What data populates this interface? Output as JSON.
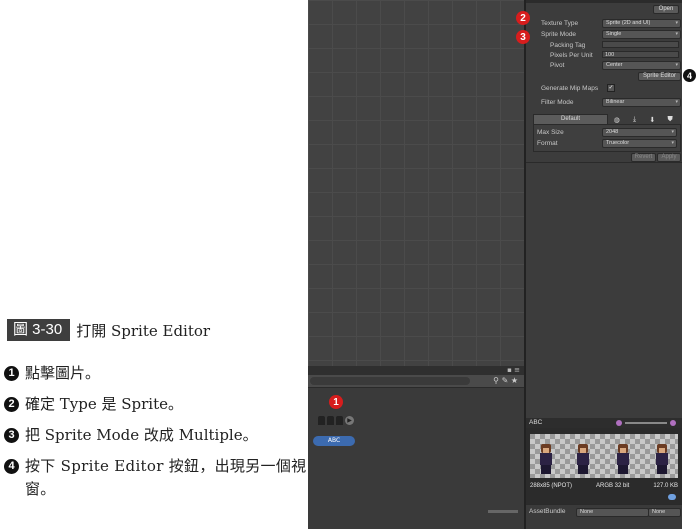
{
  "caption": {
    "label": "圖 3-30",
    "title": "打開 Sprite Editor"
  },
  "steps": [
    {
      "num": "1",
      "text": "點擊圖片。"
    },
    {
      "num": "2",
      "text": "確定 Type 是 Sprite。"
    },
    {
      "num": "3",
      "text": "把 Sprite Mode 改成 Multiple。"
    },
    {
      "num": "4",
      "text": "按下 Sprite Editor 按鈕，出現另一個視窗。"
    }
  ],
  "callouts": {
    "c1": "1",
    "c2": "2",
    "c3": "3",
    "c4": "4"
  },
  "project": {
    "asset_label": "ABC"
  },
  "inspector": {
    "open_button": "Open",
    "texture_type_label": "Texture Type",
    "texture_type_value": "Sprite (2D and UI)",
    "sprite_mode_label": "Sprite Mode",
    "sprite_mode_value": "Single",
    "packing_tag_label": "Packing Tag",
    "ppu_label": "Pixels Per Unit",
    "ppu_value": "100",
    "pivot_label": "Pivot",
    "pivot_value": "Center",
    "sprite_editor_button": "Sprite Editor",
    "mipmaps_label": "Generate Mip Maps",
    "mipmaps_checked": "✓",
    "filter_mode_label": "Filter Mode",
    "filter_mode_value": "Bilinear",
    "default_tab": "Default",
    "max_size_label": "Max Size",
    "max_size_value": "2048",
    "format_label": "Format",
    "format_value": "Truecolor",
    "revert_button": "Revert",
    "apply_button": "Apply"
  },
  "preview": {
    "title": "ABC",
    "info_left": "288x85 (NPOT)",
    "info_mid": "ARGB 32 bit",
    "info_right": "127.0 KB"
  },
  "assetbundle": {
    "label": "AssetBundle",
    "name": "None",
    "variant": "None"
  }
}
